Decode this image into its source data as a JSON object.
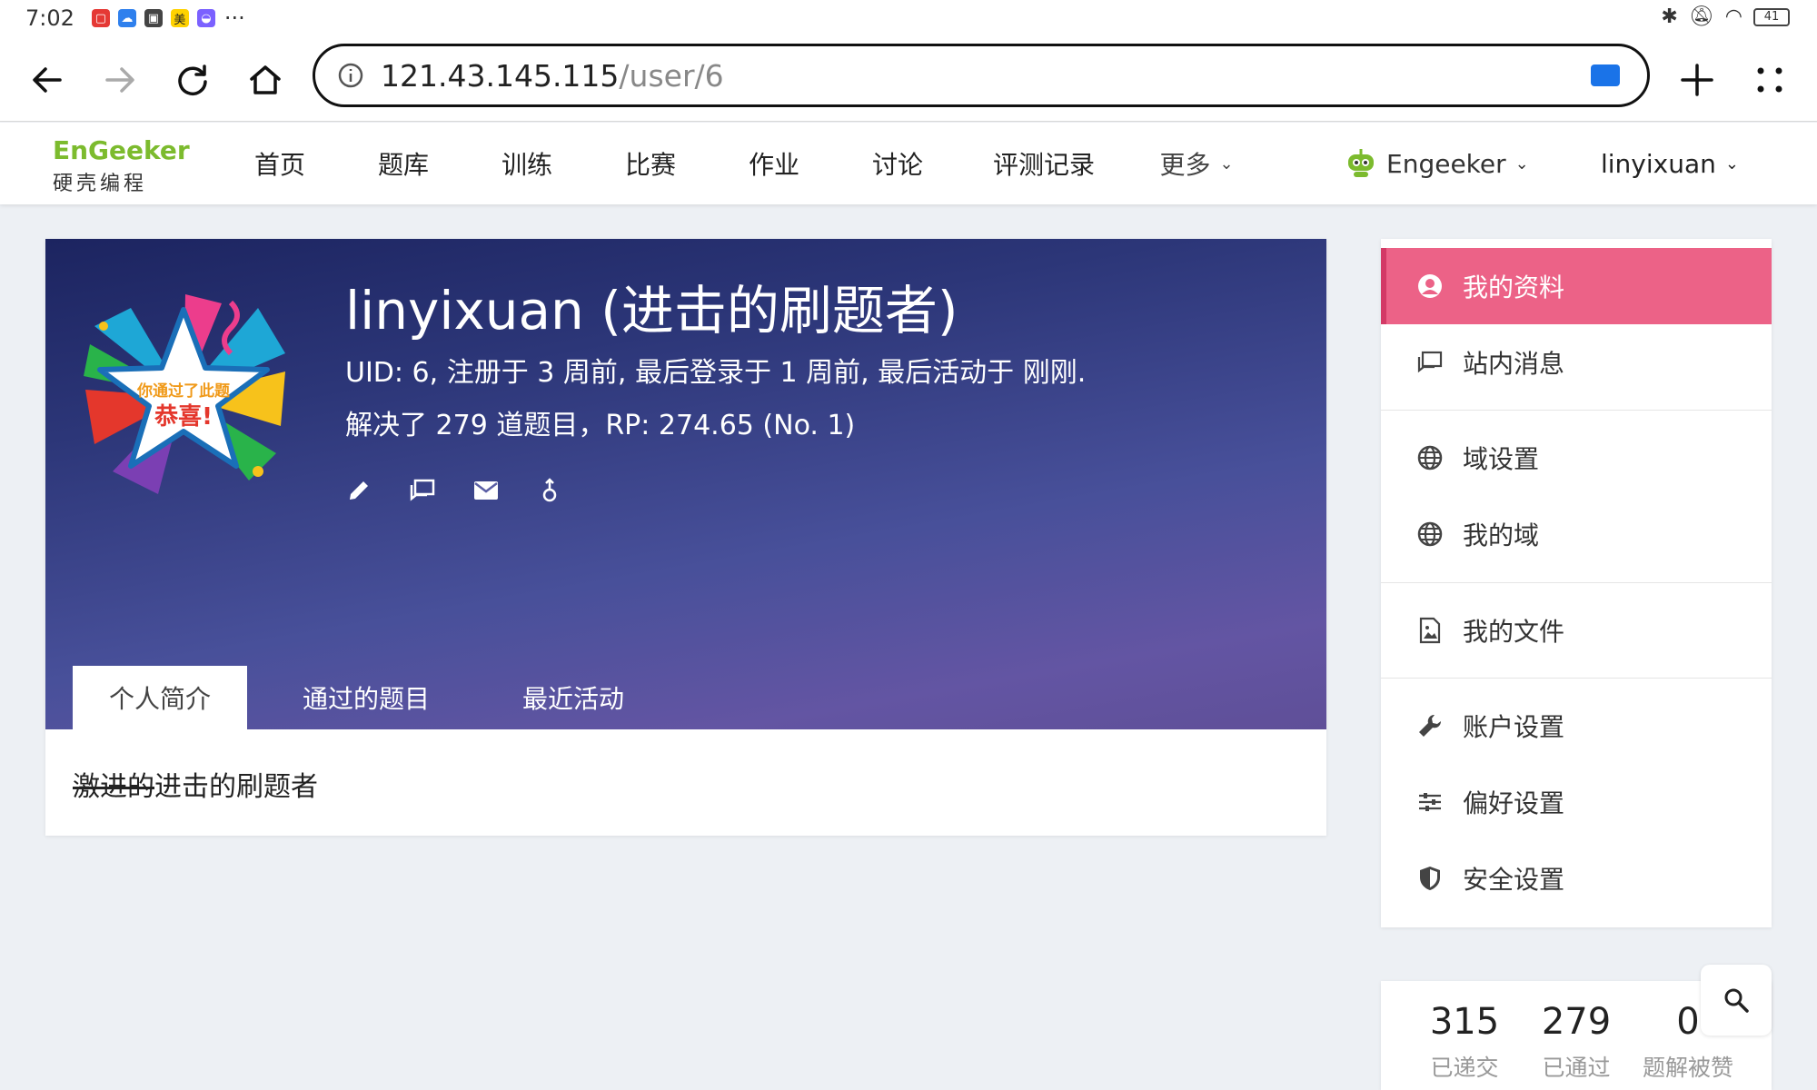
{
  "status_bar": {
    "time": "7:02",
    "more": "···",
    "battery": "41"
  },
  "browser": {
    "url_host": "121.43.145.115",
    "url_path": "/user/6",
    "colors": {
      "cast_icon": "#1a73e8"
    }
  },
  "site": {
    "logo_text": "EnGeeker",
    "logo_subtitle": "硬壳编程",
    "nav": [
      {
        "label": "首页"
      },
      {
        "label": "题库"
      },
      {
        "label": "训练"
      },
      {
        "label": "比赛"
      },
      {
        "label": "作业"
      },
      {
        "label": "讨论"
      },
      {
        "label": "评测记录"
      },
      {
        "label": "更多"
      }
    ],
    "domain_menu": "Engeeker",
    "user_menu": "linyixuan"
  },
  "profile": {
    "title": "linyixuan (进击的刷题者)",
    "meta": "UID: 6, 注册于 3 周前, 最后登录于 1 周前, 最后活动于 刚刚.",
    "solved": "解决了 279 道题目，RP: 274.65 (No. 1)",
    "avatar_text_1": "你通过了此题",
    "avatar_text_2": "恭喜!",
    "tabs": [
      {
        "label": "个人简介"
      },
      {
        "label": "通过的题目"
      },
      {
        "label": "最近活动"
      }
    ],
    "bio_struck": "激进的",
    "bio_rest": "进击的刷题者",
    "colors": {
      "banner_top": "#1c2460",
      "banner_bottom": "#5f4f98"
    }
  },
  "sidebar": {
    "items": [
      {
        "label": "我的资料",
        "icon": "account-circle-icon"
      },
      {
        "label": "站内消息",
        "icon": "message-icon"
      },
      {
        "label": "域设置",
        "icon": "globe-icon"
      },
      {
        "label": "我的域",
        "icon": "globe-icon"
      },
      {
        "label": "我的文件",
        "icon": "file-image-icon"
      },
      {
        "label": "账户设置",
        "icon": "wrench-icon"
      },
      {
        "label": "偏好设置",
        "icon": "sliders-icon"
      },
      {
        "label": "安全设置",
        "icon": "shield-icon"
      }
    ],
    "colors": {
      "active_bg": "#ec6287"
    }
  },
  "stats": [
    {
      "value": "315",
      "label": "已递交"
    },
    {
      "value": "279",
      "label": "已通过"
    },
    {
      "value": "0",
      "label": "题解被赞"
    }
  ]
}
